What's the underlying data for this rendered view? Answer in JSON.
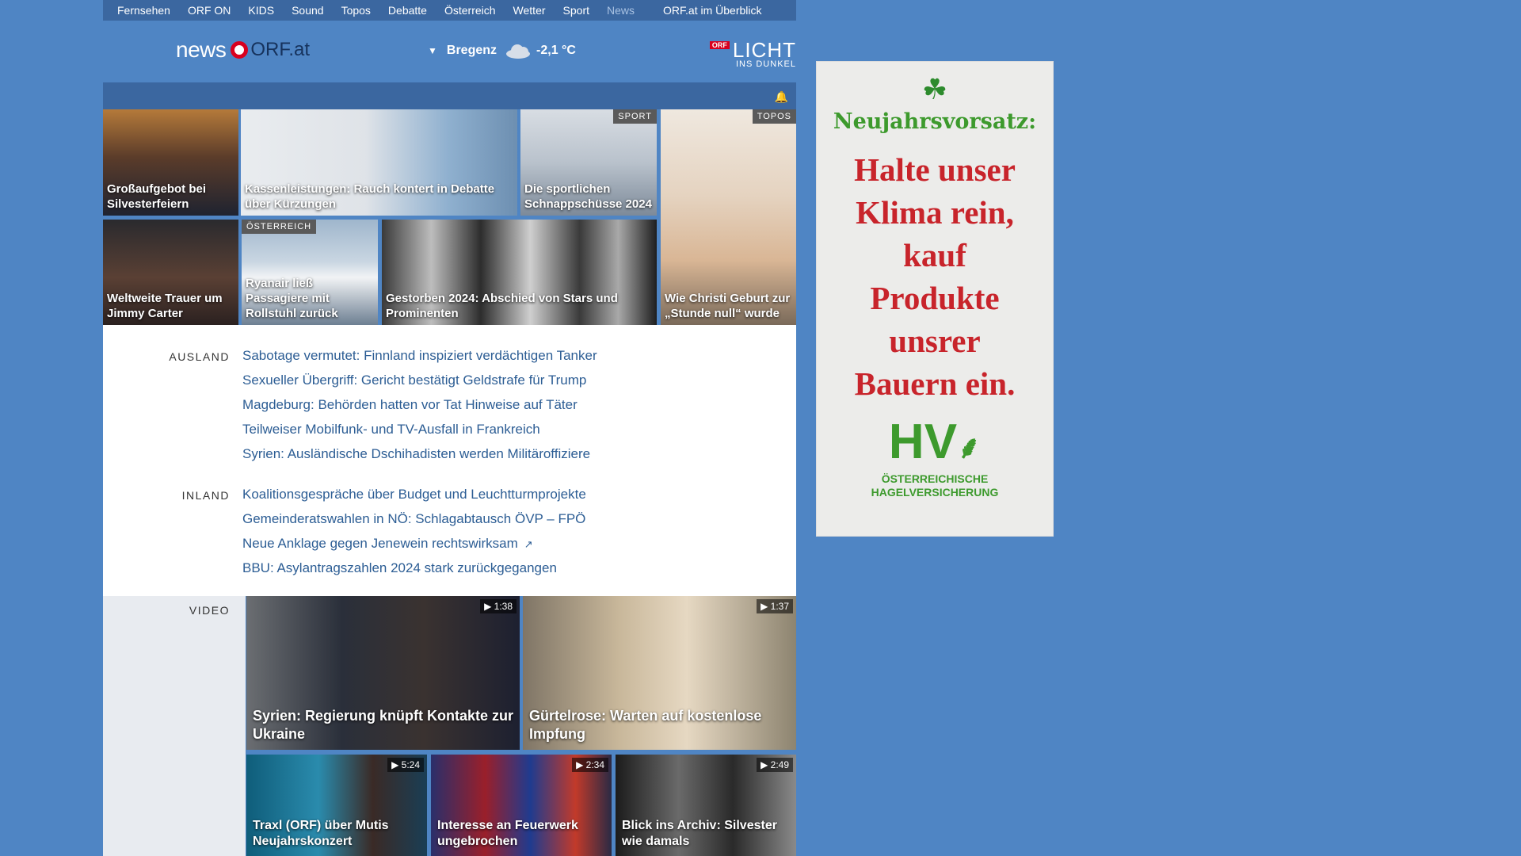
{
  "nav": {
    "items": [
      "Fernsehen",
      "ORF ON",
      "KIDS",
      "Sound",
      "Topos",
      "Debatte",
      "Österreich",
      "Wetter",
      "Sport",
      "News"
    ],
    "active_index": 9,
    "overview": "ORF.at im Überblick"
  },
  "logo": {
    "news": "news",
    "orf": "ORF.at"
  },
  "weather": {
    "city": "Bregenz",
    "temp": "-2,1 °C",
    "icon": "cloud-icon"
  },
  "licht": {
    "badge": "ORF",
    "title": "LICHT",
    "subtitle": "INS DUNKEL"
  },
  "teasers": [
    {
      "caption": "Großaufgebot bei Silvesterfeiern",
      "tag": ""
    },
    {
      "caption": "Kassenleistungen: Rauch kontert in Debatte über Kürzungen",
      "tag": ""
    },
    {
      "caption": "Die sportlichen Schnappschüsse 2024",
      "tag": "SPORT"
    },
    {
      "caption": "Wie Christi Geburt zur „Stunde null“ wurde",
      "tag": "TOPOS"
    },
    {
      "caption": "Weltweite Trauer um Jimmy Carter",
      "tag": ""
    },
    {
      "caption": "Ryanair ließ Passagiere mit Rollstuhl zurück",
      "tag": "ÖSTERREICH"
    },
    {
      "caption": "Gestorben 2024: Abschied von Stars und Prominenten",
      "tag": ""
    }
  ],
  "sections": [
    {
      "label": "AUSLAND",
      "headlines": [
        "Sabotage vermutet: Finnland inspiziert verdächtigen Tanker",
        "Sexueller Übergriff: Gericht bestätigt Geldstrafe für Trump",
        "Magdeburg: Behörden hatten vor Tat Hinweise auf Täter",
        "Teilweiser Mobilfunk- und TV-Ausfall in Frankreich",
        "Syrien: Ausländische Dschihadisten werden Militäroffiziere"
      ]
    },
    {
      "label": "INLAND",
      "headlines": [
        "Koalitionsgespräche über Budget und Leuchtturmprojekte",
        "Gemeinderatswahlen in NÖ: Schlagabtausch ÖVP – FPÖ",
        "Neue Anklage gegen Jenewein rechtswirksam",
        "BBU: Asylantragszahlen 2024 stark zurückgegangen"
      ]
    }
  ],
  "video": {
    "label": "VIDEO",
    "items": [
      {
        "caption": "Syrien: Regierung knüpft Kontakte zur Ukraine",
        "duration": "1:38"
      },
      {
        "caption": "Gürtelrose: Warten auf kostenlose Impfung",
        "duration": "1:37"
      },
      {
        "caption": "Traxl (ORF) über Mutis Neujahrskonzert",
        "duration": "5:24"
      },
      {
        "caption": "Interesse an Feuerwerk ungebrochen",
        "duration": "2:34"
      },
      {
        "caption": "Blick ins Archiv: Silvester wie damals",
        "duration": "2:49"
      }
    ]
  },
  "ad": {
    "kicker": "Neujahrsvorsatz:",
    "lines": [
      "Halte unser",
      "Klima rein,",
      "kauf",
      "Produkte",
      "unsrer",
      "Bauern ein."
    ],
    "brand": "HV",
    "brand_name_1": "ÖSTERREICHISCHE",
    "brand_name_2": "HAGELVERSICHERUNG"
  },
  "colors": {
    "page_bg": "#4f85c4",
    "nav_bg": "#3b67a0",
    "headline": "#2c5d94",
    "orf_red": "#d9001e",
    "ad_red": "#c8242b",
    "ad_green": "#3d9a2d"
  }
}
